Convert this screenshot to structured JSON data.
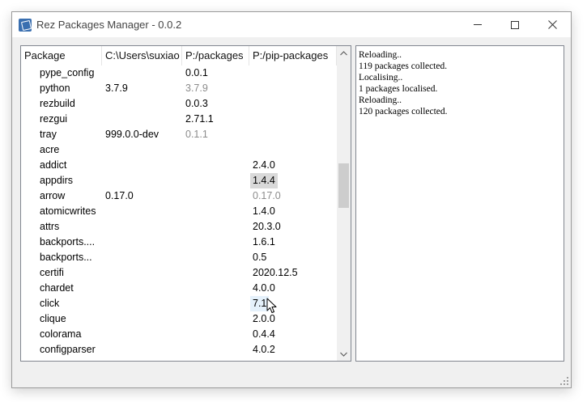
{
  "window": {
    "title": "Rez Packages Manager - 0.0.2"
  },
  "table": {
    "columns": [
      "Package",
      "C:\\Users\\suxiao",
      "P:/packages",
      "P:/pip-packages"
    ],
    "rows": [
      {
        "name": "pype_config",
        "local": "",
        "packages": "0.0.1",
        "pip": ""
      },
      {
        "name": "python",
        "local": "3.7.9",
        "packages": "3.7.9",
        "pip": ""
      },
      {
        "name": "rezbuild",
        "local": "",
        "packages": "0.0.3",
        "pip": ""
      },
      {
        "name": "rezgui",
        "local": "",
        "packages": "2.71.1",
        "pip": ""
      },
      {
        "name": "tray",
        "local": "999.0.0-dev",
        "packages": "0.1.1",
        "pip": ""
      },
      {
        "name": "acre",
        "local": "",
        "packages": "",
        "pip": ""
      },
      {
        "name": "addict",
        "local": "",
        "packages": "",
        "pip": "2.4.0"
      },
      {
        "name": "appdirs",
        "local": "",
        "packages": "",
        "pip": "1.4.4"
      },
      {
        "name": "arrow",
        "local": "0.17.0",
        "packages": "",
        "pip": "0.17.0"
      },
      {
        "name": "atomicwrites",
        "local": "",
        "packages": "",
        "pip": "1.4.0"
      },
      {
        "name": "attrs",
        "local": "",
        "packages": "",
        "pip": "20.3.0"
      },
      {
        "name": "backports....",
        "local": "",
        "packages": "",
        "pip": "1.6.1"
      },
      {
        "name": "backports...",
        "local": "",
        "packages": "",
        "pip": "0.5"
      },
      {
        "name": "certifi",
        "local": "",
        "packages": "",
        "pip": "2020.12.5"
      },
      {
        "name": "chardet",
        "local": "",
        "packages": "",
        "pip": "4.0.0"
      },
      {
        "name": "click",
        "local": "",
        "packages": "",
        "pip": "7.1"
      },
      {
        "name": "clique",
        "local": "",
        "packages": "",
        "pip": "2.0.0"
      },
      {
        "name": "colorama",
        "local": "",
        "packages": "",
        "pip": "0.4.4"
      },
      {
        "name": "configparser",
        "local": "",
        "packages": "",
        "pip": "4.0.2"
      }
    ]
  },
  "log": {
    "lines": [
      "Reloading..",
      "119 packages collected.",
      "Localising..",
      "1 packages localised.",
      "Reloading..",
      "120 packages collected."
    ]
  },
  "icons": {
    "app": "app-icon",
    "minimize": "minimize-icon",
    "maximize": "maximize-icon",
    "close": "close-icon",
    "scroll_up": "chevron-up-icon",
    "scroll_down": "chevron-down-icon",
    "cursor": "mouse-cursor-icon",
    "grip": "resize-grip-icon"
  },
  "colors": {
    "selected_cell": "#d9d9d9",
    "hover_cell": "#e5f1fb",
    "dim_text": "#8c8c8c"
  }
}
